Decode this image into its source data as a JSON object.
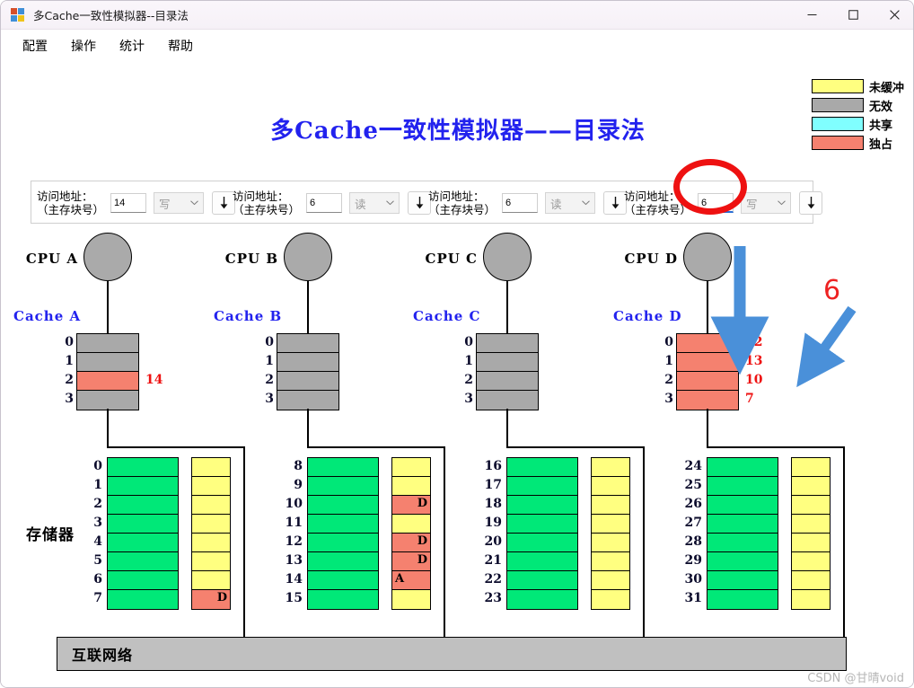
{
  "window": {
    "title": "多Cache一致性模拟器--目录法",
    "minimize_label": "最小化",
    "maximize_label": "最大化",
    "close_label": "关闭"
  },
  "menu": {
    "items": [
      {
        "label": "配置"
      },
      {
        "label": "操作"
      },
      {
        "label": "统计"
      },
      {
        "label": "帮助"
      }
    ]
  },
  "heading": {
    "title": "多Cache一致性模拟器——目录法"
  },
  "legend": {
    "items": [
      {
        "label": "未缓冲",
        "color": "#ffff80"
      },
      {
        "label": "无效",
        "color": "#a9a9a9"
      },
      {
        "label": "共享",
        "color": "#80ffff"
      },
      {
        "label": "独占",
        "color": "#f5816f"
      }
    ]
  },
  "controls": {
    "label_line1": "访问地址：",
    "label_line2": "（主存块号）",
    "go_label": "↓",
    "panels": [
      {
        "id": "A",
        "address": "14",
        "operation": "写",
        "focused": false
      },
      {
        "id": "B",
        "address": "6",
        "operation": "读",
        "focused": false
      },
      {
        "id": "C",
        "address": "6",
        "operation": "读",
        "focused": false
      },
      {
        "id": "D",
        "address": "6",
        "operation": "写",
        "focused": true
      }
    ],
    "operation_options": [
      "读",
      "写"
    ]
  },
  "clusters": [
    {
      "cpu_label": "CPU A",
      "cache_label": "Cache A",
      "cache_rows": [
        {
          "index": "0",
          "state": "invalid",
          "color": "#a9a9a9",
          "tag": ""
        },
        {
          "index": "1",
          "state": "invalid",
          "color": "#a9a9a9",
          "tag": ""
        },
        {
          "index": "2",
          "state": "exclusive",
          "color": "#f5816f",
          "tag": "14"
        },
        {
          "index": "3",
          "state": "invalid",
          "color": "#a9a9a9",
          "tag": ""
        }
      ]
    },
    {
      "cpu_label": "CPU B",
      "cache_label": "Cache B",
      "cache_rows": [
        {
          "index": "0",
          "state": "invalid",
          "color": "#a9a9a9",
          "tag": ""
        },
        {
          "index": "1",
          "state": "invalid",
          "color": "#a9a9a9",
          "tag": ""
        },
        {
          "index": "2",
          "state": "invalid",
          "color": "#a9a9a9",
          "tag": ""
        },
        {
          "index": "3",
          "state": "invalid",
          "color": "#a9a9a9",
          "tag": ""
        }
      ]
    },
    {
      "cpu_label": "CPU C",
      "cache_label": "Cache C",
      "cache_rows": [
        {
          "index": "0",
          "state": "invalid",
          "color": "#a9a9a9",
          "tag": ""
        },
        {
          "index": "1",
          "state": "invalid",
          "color": "#a9a9a9",
          "tag": ""
        },
        {
          "index": "2",
          "state": "invalid",
          "color": "#a9a9a9",
          "tag": ""
        },
        {
          "index": "3",
          "state": "invalid",
          "color": "#a9a9a9",
          "tag": ""
        }
      ]
    },
    {
      "cpu_label": "CPU D",
      "cache_label": "Cache D",
      "cache_rows": [
        {
          "index": "0",
          "state": "exclusive",
          "color": "#f5816f",
          "tag": "12"
        },
        {
          "index": "1",
          "state": "exclusive",
          "color": "#f5816f",
          "tag": "13"
        },
        {
          "index": "2",
          "state": "exclusive",
          "color": "#f5816f",
          "tag": "10"
        },
        {
          "index": "3",
          "state": "exclusive",
          "color": "#f5816f",
          "tag": "7"
        }
      ]
    }
  ],
  "memory": {
    "title": "存储器",
    "banks": [
      {
        "rows": [
          {
            "index": "0",
            "data_color": "#00e878",
            "dir_color": "#ffff80",
            "dir_mark": "",
            "dir_align": "right"
          },
          {
            "index": "1",
            "data_color": "#00e878",
            "dir_color": "#ffff80",
            "dir_mark": "",
            "dir_align": "right"
          },
          {
            "index": "2",
            "data_color": "#00e878",
            "dir_color": "#ffff80",
            "dir_mark": "",
            "dir_align": "right"
          },
          {
            "index": "3",
            "data_color": "#00e878",
            "dir_color": "#ffff80",
            "dir_mark": "",
            "dir_align": "right"
          },
          {
            "index": "4",
            "data_color": "#00e878",
            "dir_color": "#ffff80",
            "dir_mark": "",
            "dir_align": "right"
          },
          {
            "index": "5",
            "data_color": "#00e878",
            "dir_color": "#ffff80",
            "dir_mark": "",
            "dir_align": "right"
          },
          {
            "index": "6",
            "data_color": "#00e878",
            "dir_color": "#ffff80",
            "dir_mark": "",
            "dir_align": "right"
          },
          {
            "index": "7",
            "data_color": "#00e878",
            "dir_color": "#f5816f",
            "dir_mark": "D",
            "dir_align": "right"
          }
        ]
      },
      {
        "rows": [
          {
            "index": "8",
            "data_color": "#00e878",
            "dir_color": "#ffff80",
            "dir_mark": "",
            "dir_align": "right"
          },
          {
            "index": "9",
            "data_color": "#00e878",
            "dir_color": "#ffff80",
            "dir_mark": "",
            "dir_align": "right"
          },
          {
            "index": "10",
            "data_color": "#00e878",
            "dir_color": "#f5816f",
            "dir_mark": "D",
            "dir_align": "right"
          },
          {
            "index": "11",
            "data_color": "#00e878",
            "dir_color": "#ffff80",
            "dir_mark": "",
            "dir_align": "right"
          },
          {
            "index": "12",
            "data_color": "#00e878",
            "dir_color": "#f5816f",
            "dir_mark": "D",
            "dir_align": "right"
          },
          {
            "index": "13",
            "data_color": "#00e878",
            "dir_color": "#f5816f",
            "dir_mark": "D",
            "dir_align": "right"
          },
          {
            "index": "14",
            "data_color": "#00e878",
            "dir_color": "#f5816f",
            "dir_mark": "A",
            "dir_align": "left"
          },
          {
            "index": "15",
            "data_color": "#00e878",
            "dir_color": "#ffff80",
            "dir_mark": "",
            "dir_align": "right"
          }
        ]
      },
      {
        "rows": [
          {
            "index": "16",
            "data_color": "#00e878",
            "dir_color": "#ffff80",
            "dir_mark": "",
            "dir_align": "right"
          },
          {
            "index": "17",
            "data_color": "#00e878",
            "dir_color": "#ffff80",
            "dir_mark": "",
            "dir_align": "right"
          },
          {
            "index": "18",
            "data_color": "#00e878",
            "dir_color": "#ffff80",
            "dir_mark": "",
            "dir_align": "right"
          },
          {
            "index": "19",
            "data_color": "#00e878",
            "dir_color": "#ffff80",
            "dir_mark": "",
            "dir_align": "right"
          },
          {
            "index": "20",
            "data_color": "#00e878",
            "dir_color": "#ffff80",
            "dir_mark": "",
            "dir_align": "right"
          },
          {
            "index": "21",
            "data_color": "#00e878",
            "dir_color": "#ffff80",
            "dir_mark": "",
            "dir_align": "right"
          },
          {
            "index": "22",
            "data_color": "#00e878",
            "dir_color": "#ffff80",
            "dir_mark": "",
            "dir_align": "right"
          },
          {
            "index": "23",
            "data_color": "#00e878",
            "dir_color": "#ffff80",
            "dir_mark": "",
            "dir_align": "right"
          }
        ]
      },
      {
        "rows": [
          {
            "index": "24",
            "data_color": "#00e878",
            "dir_color": "#ffff80",
            "dir_mark": "",
            "dir_align": "right"
          },
          {
            "index": "25",
            "data_color": "#00e878",
            "dir_color": "#ffff80",
            "dir_mark": "",
            "dir_align": "right"
          },
          {
            "index": "26",
            "data_color": "#00e878",
            "dir_color": "#ffff80",
            "dir_mark": "",
            "dir_align": "right"
          },
          {
            "index": "27",
            "data_color": "#00e878",
            "dir_color": "#ffff80",
            "dir_mark": "",
            "dir_align": "right"
          },
          {
            "index": "28",
            "data_color": "#00e878",
            "dir_color": "#ffff80",
            "dir_mark": "",
            "dir_align": "right"
          },
          {
            "index": "29",
            "data_color": "#00e878",
            "dir_color": "#ffff80",
            "dir_mark": "",
            "dir_align": "right"
          },
          {
            "index": "30",
            "data_color": "#00e878",
            "dir_color": "#ffff80",
            "dir_mark": "",
            "dir_align": "right"
          },
          {
            "index": "31",
            "data_color": "#00e878",
            "dir_color": "#ffff80",
            "dir_mark": "",
            "dir_align": "right"
          }
        ]
      }
    ]
  },
  "bus": {
    "label": "互联网络"
  },
  "annotations": {
    "number_six": "6",
    "circle_color": "#ee1111",
    "arrow_color": "#4a90d9"
  },
  "watermark": {
    "text": "CSDN @甘晴void"
  }
}
